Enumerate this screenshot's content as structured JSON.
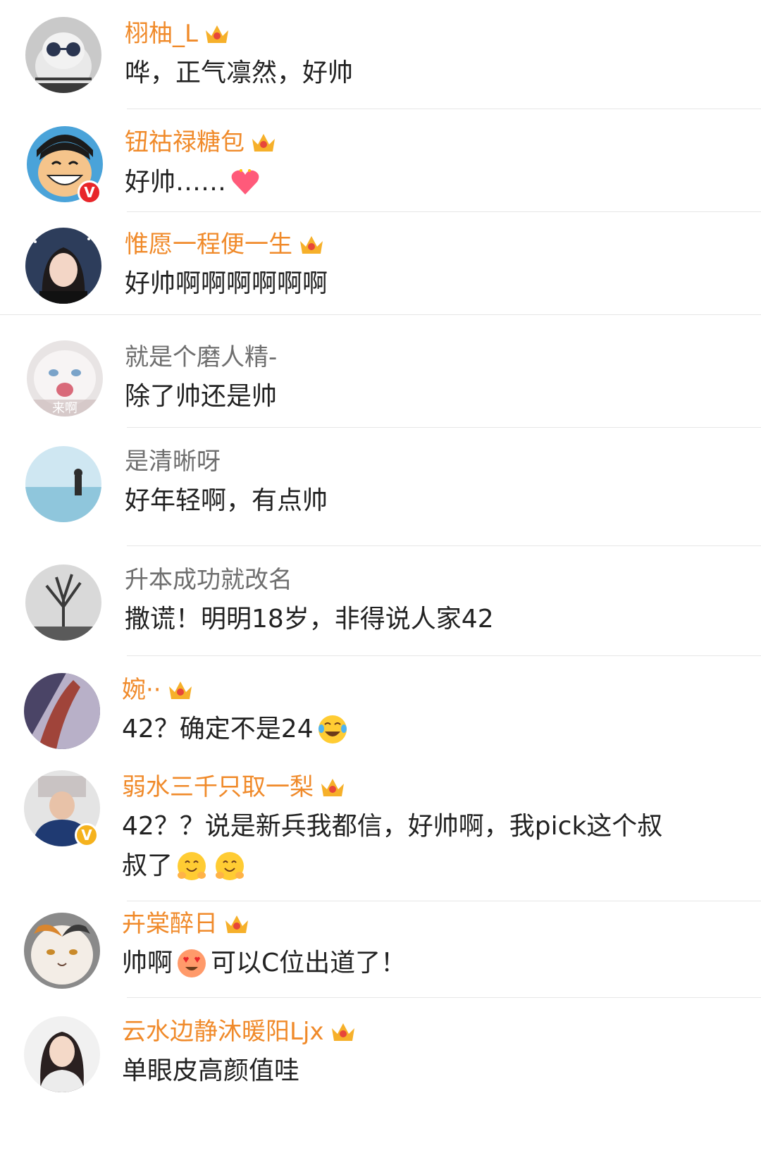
{
  "comments": [
    {
      "name": "栩柚_L",
      "text": "哗，正气凛然，好帅",
      "vip": true
    },
    {
      "name": "钮祜禄糖包",
      "text": "好帅……",
      "vip": true,
      "emoji": "heart-emoji"
    },
    {
      "name": "惟愿一程便一生",
      "text": "好帅啊啊啊啊啊啊",
      "vip": true
    },
    {
      "name": "就是个磨人精-",
      "text": "除了帅还是帅",
      "vip": false,
      "avatar_caption": "来啊"
    },
    {
      "name": "是清晰呀",
      "text": "好年轻啊，有点帅",
      "vip": false
    },
    {
      "name": "升本成功就改名",
      "text": "撒谎！明明18岁，非得说人家42",
      "vip": false
    },
    {
      "name": "婉··",
      "text": "42？确定不是24",
      "vip": true,
      "emoji": "laughing-tears-emoji"
    },
    {
      "name": "弱水三千只取一梨",
      "text_line1": "42？？说是新兵我都信，好帅啊，我pick这个叔",
      "text_line2": "叔了",
      "vip": true,
      "emoji": "hug-face-emoji"
    },
    {
      "name": "卉棠醉日",
      "text_before": "帅啊",
      "text_after": "可以C位出道了！",
      "vip": true,
      "emoji": "heart-eyes-emoji"
    },
    {
      "name": "云水边静沐暖阳Ljx",
      "text": "单眼皮高颜值哇",
      "vip": true
    }
  ],
  "colors": {
    "vip_name": "#f08a2a",
    "plain_name": "#6e6e6e",
    "text": "#222222",
    "verified_red": "#e8262a",
    "verified_gold": "#f5b21d"
  },
  "icons": [
    "crown-icon",
    "verified-badge-icon"
  ]
}
